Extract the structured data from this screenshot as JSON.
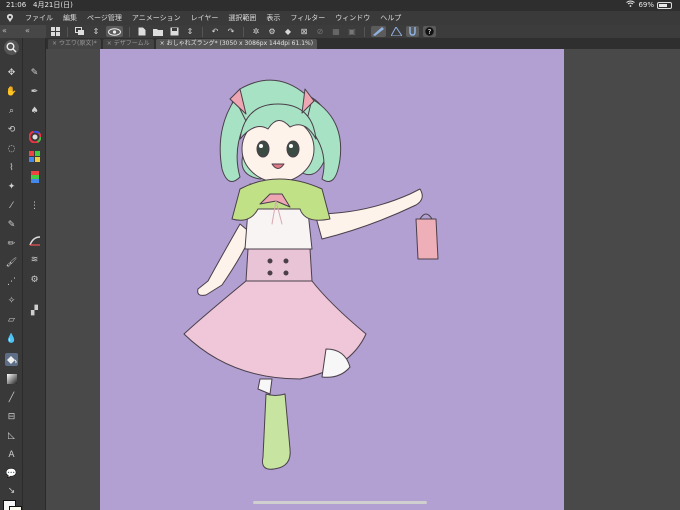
{
  "status": {
    "time": "21:06",
    "date": "4月21日(日)",
    "battery": "69%",
    "battery_level": 0.69
  },
  "menu": [
    "ファイル",
    "編集",
    "ページ管理",
    "アニメーション",
    "レイヤー",
    "選択範囲",
    "表示",
    "フィルター",
    "ウィンドウ",
    "ヘルプ"
  ],
  "tabs": [
    {
      "label": "ウエワ(原文)*",
      "active": false
    },
    {
      "label": "デザフームル",
      "active": false
    },
    {
      "label": "おしゃれズラング* (3050 x 3086px 144dpi 61.1%)",
      "active": true
    }
  ],
  "colors": {
    "canvas_bg": "#b1a0d1",
    "main_color": "#f6f6f6",
    "sub_color": "#fdfbee",
    "active_tool": "#5d6e86"
  },
  "icons": {
    "command_bar": [
      "grid-icon",
      "copy-icon",
      "eye-icon",
      "folder-icon",
      "save-icon",
      "undo-icon",
      "redo-icon",
      "fill-icon",
      "transform-icon",
      "help-icon"
    ],
    "tools": [
      "zoom-icon",
      "hand-icon",
      "pen-icon",
      "brush-icon",
      "eraser-icon",
      "fill-icon",
      "gradient-icon",
      "text-icon",
      "balloon-icon"
    ]
  }
}
